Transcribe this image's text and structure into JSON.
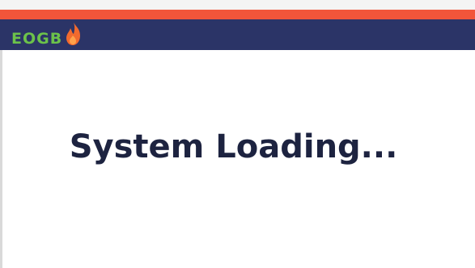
{
  "brand": {
    "logo_text": "EOGB",
    "logo_color": "#6cc24a",
    "flame_icon": "flame-icon"
  },
  "colors": {
    "accent": "#f2553a",
    "header": "#2b3467",
    "text": "#1d2340",
    "background": "#ffffff"
  },
  "status": {
    "message": "System Loading..."
  }
}
